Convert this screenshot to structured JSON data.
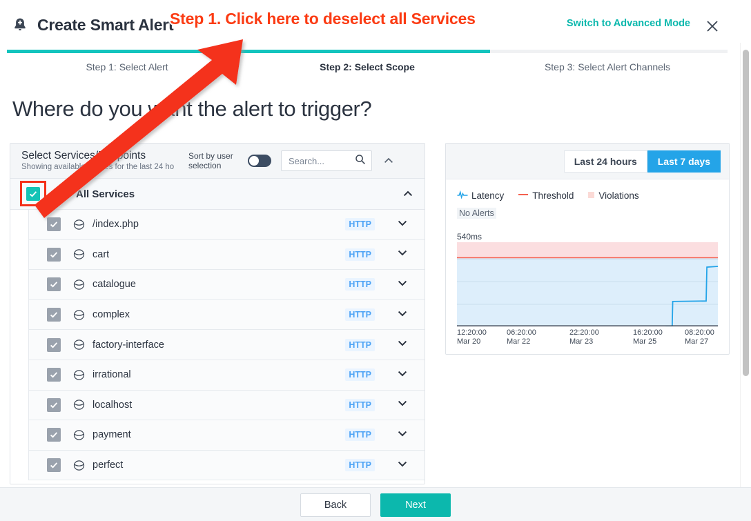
{
  "header": {
    "icon": "bell-add-icon",
    "title": "Create Smart Alert",
    "advanced_mode_label": "Switch to Advanced Mode",
    "close_icon": "close-icon",
    "accent_color": "#0bb8ad"
  },
  "steps": {
    "progress_percent": 67,
    "items": [
      {
        "label": "Step 1: Select Alert",
        "active": false
      },
      {
        "label": "Step 2: Select Scope",
        "active": true
      },
      {
        "label": "Step 3: Select Alert Channels",
        "active": false
      }
    ]
  },
  "page_heading": "Where do you want the alert to trigger?",
  "scope_panel": {
    "title": "Select Services/Endpoints",
    "subtitle": "Showing available entities for the last 24 ho",
    "sort_label": "Sort by user selection",
    "sort_toggle_state": "off",
    "search_placeholder": "Search...",
    "search_value": "",
    "search_icon": "search-icon",
    "collapse_icon": "chevron-up-icon",
    "all_services": {
      "label": "All Services",
      "icon": "service-group-icon",
      "checked": true,
      "expanded": true,
      "checkbox_color": "#14c3b6"
    },
    "services": [
      {
        "name": "/index.php",
        "protocol": "HTTP",
        "checked": true
      },
      {
        "name": "cart",
        "protocol": "HTTP",
        "checked": true
      },
      {
        "name": "catalogue",
        "protocol": "HTTP",
        "checked": true
      },
      {
        "name": "complex",
        "protocol": "HTTP",
        "checked": true
      },
      {
        "name": "factory-interface",
        "protocol": "HTTP",
        "checked": true
      },
      {
        "name": "irrational",
        "protocol": "HTTP",
        "checked": true
      },
      {
        "name": "localhost",
        "protocol": "HTTP",
        "checked": true
      },
      {
        "name": "payment",
        "protocol": "HTTP",
        "checked": true
      },
      {
        "name": "perfect",
        "protocol": "HTTP",
        "checked": true
      }
    ]
  },
  "chart_panel": {
    "ranges": [
      {
        "label": "Last 24 hours",
        "active": false
      },
      {
        "label": "Last 7 days",
        "active": true
      }
    ],
    "legend": [
      {
        "label": "Latency",
        "icon": "latency-wave-icon",
        "color": "#24a4e8"
      },
      {
        "label": "Threshold",
        "icon": "threshold-line-icon",
        "color": "#f4604f"
      },
      {
        "label": "Violations",
        "icon": "violations-swatch-icon",
        "color": "#fbdad6"
      }
    ],
    "status": "No Alerts"
  },
  "chart_data": {
    "type": "line",
    "title": "",
    "ylabel": "540ms",
    "ymax_label": "540ms",
    "xlabel": "",
    "grid": true,
    "legend_position": "top-left",
    "threshold": 480,
    "ylim": [
      0,
      540
    ],
    "violation_band": [
      480,
      540
    ],
    "x_ticks": [
      {
        "time": "12:20:00",
        "date": "Mar 20"
      },
      {
        "time": "06:20:00",
        "date": "Mar 22"
      },
      {
        "time": "22:20:00",
        "date": "Mar 23"
      },
      {
        "time": "16:20:00",
        "date": "Mar 25"
      },
      {
        "time": "08:20:00",
        "date": "Mar 27"
      }
    ],
    "series": [
      {
        "name": "Latency",
        "color": "#24a4e8",
        "points": [
          {
            "x": 0.8,
            "y": 0
          },
          {
            "x": 0.825,
            "y": 0
          },
          {
            "x": 0.827,
            "y": 160
          },
          {
            "x": 0.955,
            "y": 163
          },
          {
            "x": 0.958,
            "y": 380
          },
          {
            "x": 1.0,
            "y": 385
          }
        ]
      },
      {
        "name": "Threshold",
        "color": "#f4604f",
        "constant": 480
      }
    ]
  },
  "footer": {
    "back_label": "Back",
    "next_label": "Next",
    "next_color": "#0cb8ad"
  },
  "annotations": {
    "callout_text": "Step 1. Click here to deselect all Services",
    "callout_color": "#fb3b13",
    "arrow_color": "#f4301a",
    "highlight_box_color": "#f4301a"
  }
}
